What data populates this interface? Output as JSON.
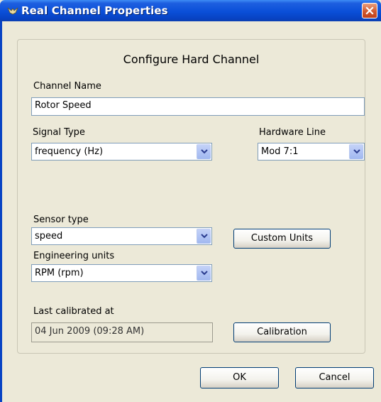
{
  "window": {
    "title": "Real Channel Properties",
    "colors": {
      "titlebar": "#0a4fd8",
      "face": "#ece9d8",
      "close": "#d1582e"
    }
  },
  "dialog": {
    "heading": "Configure Hard Channel",
    "channel_name": {
      "label": "Channel Name",
      "value": "Rotor Speed"
    },
    "signal_type": {
      "label": "Signal Type",
      "selected": "frequency (Hz)"
    },
    "hardware_line": {
      "label": "Hardware Line",
      "selected": "Mod 7:1"
    },
    "sensor_type": {
      "label": "Sensor type",
      "selected": "speed"
    },
    "engineering_units": {
      "label": "Engineering units",
      "selected": "RPM (rpm)"
    },
    "custom_units_label": "Custom Units",
    "last_calibrated": {
      "label": "Last calibrated at",
      "value": "04 Jun 2009 (09:28 AM)"
    },
    "calibration_label": "Calibration"
  },
  "footer": {
    "ok_label": "OK",
    "cancel_label": "Cancel"
  },
  "icons": {
    "title": "app-bird-icon",
    "close": "close-icon",
    "dropdown": "chevron-down-icon"
  }
}
